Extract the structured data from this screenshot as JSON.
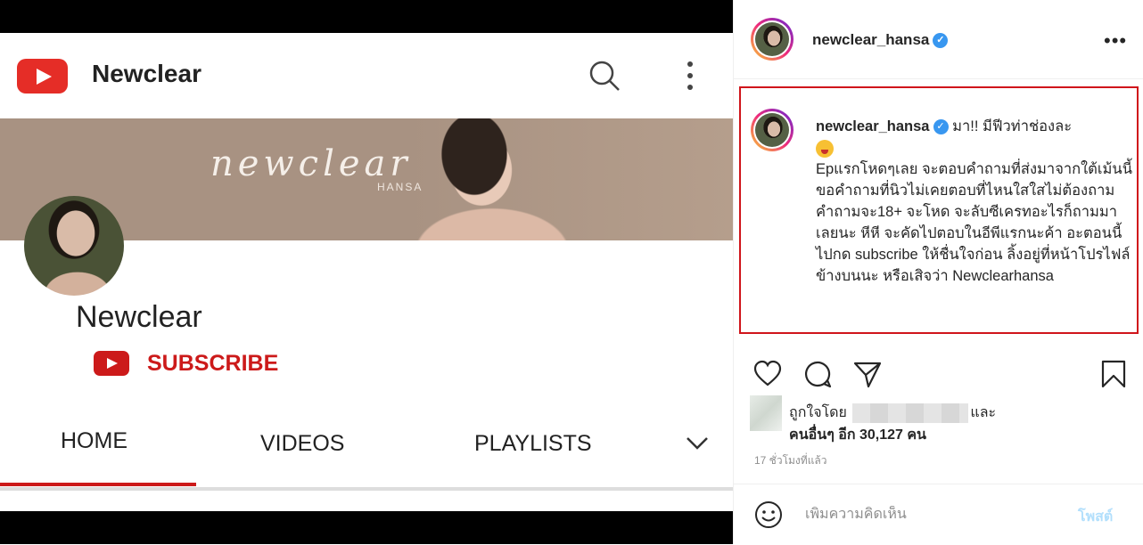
{
  "youtube": {
    "channel_header_name": "Newclear",
    "banner_script": "newclear",
    "banner_sub": "HANSA",
    "channel_name": "Newclear",
    "subscribe_label": "SUBSCRIBE",
    "tabs": [
      {
        "label": "HOME",
        "active": true
      },
      {
        "label": "VIDEOS",
        "active": false
      },
      {
        "label": "PLAYLISTS",
        "active": false
      }
    ],
    "brand_color": "#cc1a1a"
  },
  "post": {
    "username": "newclear_hansa",
    "verified": true,
    "caption": {
      "username": "newclear_hansa",
      "first_line": "มา!! มีฟีวท่าช่องละ",
      "body": "Epแรกโหดๆเลย จะตอบคำถามที่ส่งมาจากใต้เม้นนี้ ขอคำถามที่นิวไม่เคยตอบที่ไหนใสใสไม่ต้องถาม คำถามจะ18+ จะโหด จะลับซีเครทอะไรก็ถามมาเลยนะ หีหี จะคัดไปตอบในอีพีแรกนะค้า อะตอนนี้ไปกด subscribe ให้ชื่นใจก่อน ลิ้งอยู่ที่หน้าโปรไฟล์ข้างบนนะ หรือเสิจว่า",
      "tag": "Newclearhansa"
    },
    "likes": {
      "prefix": "ถูกใจโดย",
      "and": "และ",
      "others": "คนอื่นๆ อีก 30,127 คน"
    },
    "time_ago": "17 ชั่วโมงที่แล้ว",
    "comment": {
      "placeholder": "เพิ่มความคิดเห็น",
      "post_label": "โพสต์"
    },
    "highlight_color": "#d0151b",
    "accent_color": "#3897f0"
  }
}
